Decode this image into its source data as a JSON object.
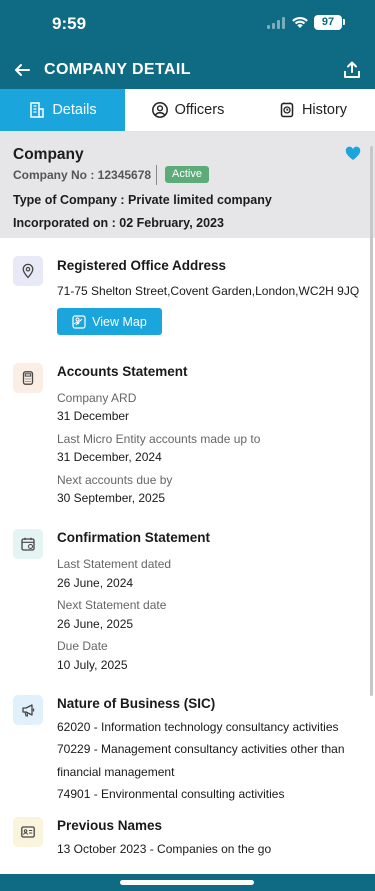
{
  "status_bar": {
    "time": "9:59",
    "battery": "97"
  },
  "header": {
    "title": "COMPANY DETAIL"
  },
  "tabs": [
    {
      "label": "Details",
      "icon": "building-icon",
      "active": true
    },
    {
      "label": "Officers",
      "icon": "user-circle-icon",
      "active": false
    },
    {
      "label": "History",
      "icon": "history-icon",
      "active": false
    }
  ],
  "company": {
    "title": "Company",
    "number": "Company No : 12345678",
    "status": "Active",
    "type": "Type of Company : Private limited company",
    "incorporated": "Incorporated on : 02 February, 2023",
    "favorite": true
  },
  "sections": {
    "office": {
      "heading": "Registered Office Address",
      "address": "71-75 Shelton Street,Covent Garden,London,WC2H 9JQ",
      "map_button": "View Map"
    },
    "accounts": {
      "heading": "Accounts Statement",
      "ard_label": "Company ARD",
      "ard_value": "31 December",
      "micro_label": "Last Micro Entity accounts made up to",
      "micro_value": "31 December, 2024",
      "due_label": "Next accounts due by",
      "due_value": "30 September, 2025"
    },
    "confirmation": {
      "heading": "Confirmation Statement",
      "last_label": "Last Statement dated",
      "last_value": "26 June, 2024",
      "next_label": "Next Statement date",
      "next_value": "26 June, 2025",
      "due_label": "Due Date",
      "due_value": "10 July, 2025"
    },
    "nature": {
      "heading": "Nature of Business (SIC)",
      "line1": "62020 - Information technology consultancy activities",
      "line2": "70229 - Management consultancy activities other than",
      "line3": "financial management",
      "line4": "74901 - Environmental consulting activities"
    },
    "previous": {
      "heading": "Previous Names",
      "line1": "13 October 2023 - Companies on the go"
    }
  },
  "colors": {
    "header_bg": "#0f6a83",
    "tab_active": "#1aa6dd",
    "active_badge": "#5cab78",
    "card_bg": "#e6e6e8"
  }
}
